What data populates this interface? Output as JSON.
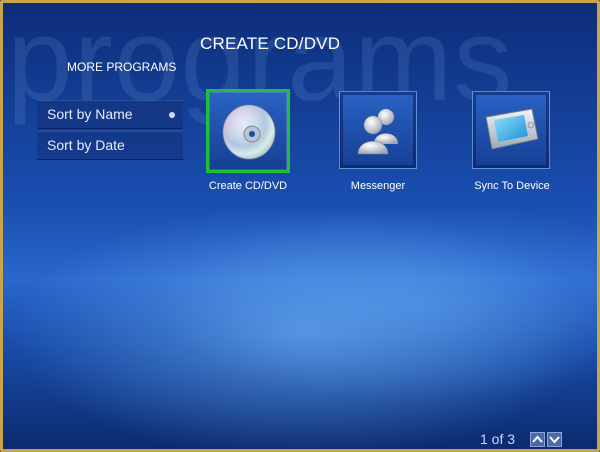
{
  "background_word": "programs",
  "header": {
    "title": "CREATE CD/DVD",
    "subtitle": "MORE PROGRAMS"
  },
  "sort_options": [
    {
      "label": "Sort by Name",
      "selected": true
    },
    {
      "label": "Sort by Date",
      "selected": false
    }
  ],
  "tiles": [
    {
      "label": "Create CD/DVD",
      "icon": "cd-dvd-icon",
      "selected": true
    },
    {
      "label": "Messenger",
      "icon": "messenger-icon",
      "selected": false
    },
    {
      "label": "Sync To Device",
      "icon": "portable-device-icon",
      "selected": false
    }
  ],
  "pager": {
    "text": "1 of 3",
    "up_icon": "chevron-up-icon",
    "down_icon": "chevron-down-icon"
  },
  "colors": {
    "frame": "#c9a44a",
    "selection": "#1fbf3a",
    "background": "#1a4fb0"
  }
}
